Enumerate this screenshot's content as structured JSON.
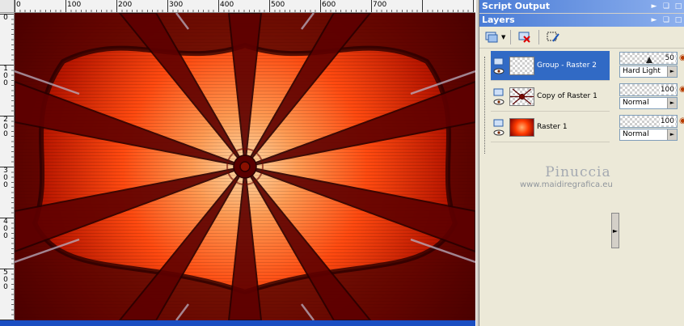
{
  "rulers": {
    "horizontal_ticks": [
      "0",
      "100",
      "200",
      "300",
      "400",
      "500"
    ],
    "vertical_ticks": [
      "0",
      "1 0 0",
      "2 0 0",
      "3 0 0",
      "4 0 0",
      "5 0 0"
    ]
  },
  "panels": {
    "script_output_title": "Script Output",
    "layers_title": "Layers"
  },
  "layers": [
    {
      "name": "Group - Raster 2",
      "opacity": "50",
      "blend": "Hard Light",
      "opacity_fraction": 0.5,
      "selected": true
    },
    {
      "name": "Copy of Raster 1",
      "opacity": "100",
      "blend": "Normal",
      "opacity_fraction": 1.0,
      "selected": false
    },
    {
      "name": "Raster 1",
      "opacity": "100",
      "blend": "Normal",
      "opacity_fraction": 1.0,
      "selected": false
    }
  ],
  "watermark": {
    "name": "Pinuccia",
    "url": "www.maidiregrafica.eu"
  },
  "icons": {
    "new_layer": "new-layer-icon",
    "delete_layer": "delete-layer-icon",
    "edit_selection": "edit-selection-icon",
    "pin": "pin-icon",
    "restore": "restore-icon",
    "close": "close-icon"
  },
  "colors": {
    "selection": "#316ac5",
    "titlebar_start": "#4a7cd6",
    "titlebar_end": "#8db0ee",
    "artwork_core": "#ffd3a0",
    "artwork_mid": "#ff4a10",
    "artwork_edge": "#5a0000"
  }
}
